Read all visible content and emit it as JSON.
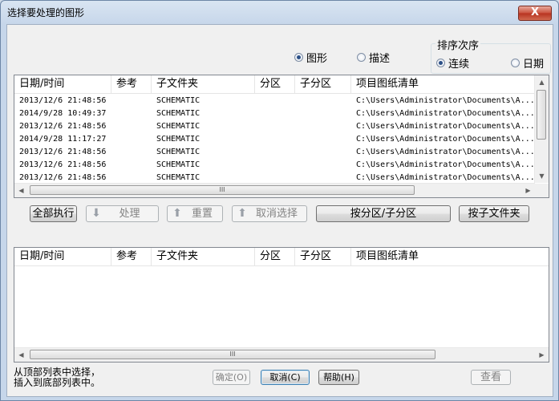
{
  "window": {
    "title": "选择要处理的图形",
    "close_glyph": "X"
  },
  "view_mode": {
    "options": [
      {
        "label": "图形",
        "checked": true
      },
      {
        "label": "描述",
        "checked": false
      }
    ]
  },
  "sort_group": {
    "title": "排序次序",
    "options": [
      {
        "label": "连续",
        "checked": true
      },
      {
        "label": "日期",
        "checked": false
      }
    ]
  },
  "columns": [
    "日期/时间",
    "参考",
    "子文件夹",
    "分区",
    "子分区",
    "项目图纸清单"
  ],
  "top_list": {
    "rows": [
      {
        "datetime": "2013/12/6 21:48:56",
        "ref": "",
        "folder": "SCHEMATIC",
        "section": "",
        "subsection": "",
        "project": "C:\\Users\\Administrator\\Documents\\A..."
      },
      {
        "datetime": "2014/9/28 10:49:37",
        "ref": "",
        "folder": "SCHEMATIC",
        "section": "",
        "subsection": "",
        "project": "C:\\Users\\Administrator\\Documents\\A..."
      },
      {
        "datetime": "2013/12/6 21:48:56",
        "ref": "",
        "folder": "SCHEMATIC",
        "section": "",
        "subsection": "",
        "project": "C:\\Users\\Administrator\\Documents\\A..."
      },
      {
        "datetime": "2014/9/28 11:17:27",
        "ref": "",
        "folder": "SCHEMATIC",
        "section": "",
        "subsection": "",
        "project": "C:\\Users\\Administrator\\Documents\\A..."
      },
      {
        "datetime": "2013/12/6 21:48:56",
        "ref": "",
        "folder": "SCHEMATIC",
        "section": "",
        "subsection": "",
        "project": "C:\\Users\\Administrator\\Documents\\A..."
      },
      {
        "datetime": "2013/12/6 21:48:56",
        "ref": "",
        "folder": "SCHEMATIC",
        "section": "",
        "subsection": "",
        "project": "C:\\Users\\Administrator\\Documents\\A..."
      },
      {
        "datetime": "2013/12/6 21:48:56",
        "ref": "",
        "folder": "SCHEMATIC",
        "section": "",
        "subsection": "",
        "project": "C:\\Users\\Administrator\\Documents\\A..."
      }
    ],
    "hscroll_grip": "III"
  },
  "action_buttons": {
    "execute_all": "全部执行",
    "process": "处理",
    "reset": "重置",
    "deselect": "取消选择",
    "by_section": "按分区/子分区",
    "by_folder": "按子文件夹"
  },
  "bottom_list": {
    "rows": [],
    "hscroll_grip": "III"
  },
  "footer": {
    "hint_line1": "从顶部列表中选择，",
    "hint_line2": "插入到底部列表中。",
    "ok": "确定(O)",
    "cancel": "取消(C)",
    "help": "帮助(H)",
    "view": "查看"
  }
}
